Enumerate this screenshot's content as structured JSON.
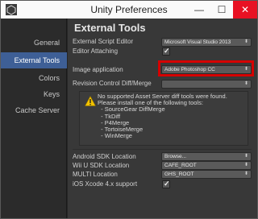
{
  "window": {
    "title": "Unity Preferences",
    "minimize": "—",
    "maximize": "☐",
    "close": "✕"
  },
  "sidebar": {
    "items": [
      {
        "label": "General"
      },
      {
        "label": "External Tools"
      },
      {
        "label": "Colors"
      },
      {
        "label": "Keys"
      },
      {
        "label": "Cache Server"
      }
    ]
  },
  "main": {
    "heading": "External Tools",
    "script_editor": {
      "label": "External Script Editor",
      "value": "Microsoft Visual Studio 2013"
    },
    "editor_attaching": {
      "label": "Editor Attaching",
      "checked": true
    },
    "image_application": {
      "label": "Image application",
      "value": "Adobe Photoshop CC"
    },
    "revision_control": {
      "label": "Revision Control Diff/Merge",
      "value": ""
    },
    "notice": {
      "lines": [
        "No supported Asset Server diff tools were found.",
        "Please install one of the following tools:",
        "  - SourceGear DiffMerge",
        "  - TkDiff",
        "  - P4Merge",
        "  - TortoiseMerge",
        "  - WinMerge"
      ]
    },
    "android_sdk": {
      "label": "Android SDK Location",
      "value": "Browse..."
    },
    "wiiu_sdk": {
      "label": "Wii U SDK Location",
      "value": "CAFE_ROOT"
    },
    "multi": {
      "label": "MULTI Location",
      "value": "GHS_ROOT"
    },
    "ios_xcode": {
      "label": "iOS Xcode 4.x support",
      "checked": true
    }
  },
  "colors": {
    "accent": "#3e5f96",
    "highlight": "#d50000",
    "close": "#e81123"
  }
}
